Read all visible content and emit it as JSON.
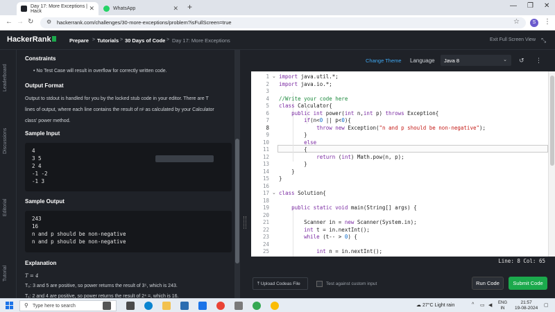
{
  "browser": {
    "tabs": [
      {
        "title": "Day 17: More Exceptions | Hack",
        "active": true
      },
      {
        "title": "WhatsApp",
        "active": false
      }
    ],
    "new_tab": "+",
    "url": "hackerrank.com/challenges/30-more-exceptions/problem?isFullScreen=true",
    "profile_initial": "S"
  },
  "header": {
    "logo": "HackerRank",
    "breadcrumb": [
      "Prepare",
      "Tutorials",
      "30 Days of Code",
      "Day 17: More Exceptions"
    ],
    "separator": ">",
    "exit_full_screen": "Exit Full Screen View"
  },
  "side_tabs": [
    "Leaderboard",
    "Discussions",
    "Editorial",
    "Tutorial"
  ],
  "problem": {
    "constraints_title": "Constraints",
    "constraint_item": "No Test Case will result in overflow for correctly written code.",
    "output_title": "Output Format",
    "output_line1": "Output to stdout is handled for you by the locked stub code in your editor. There are T",
    "output_line2": "lines of output, where each line contains the result of nᵖ as calculated by your Calculator",
    "output_line3": "class' power method.",
    "sample_input_title": "Sample Input",
    "sample_input": [
      "4",
      "3 5",
      "2 4",
      "-1 -2",
      "-1 3"
    ],
    "sample_output_title": "Sample Output",
    "sample_output": [
      "243",
      "16",
      "n and p should be non-negative",
      "n and p should be non-negative"
    ],
    "explanation_title": "Explanation",
    "explanation_t": "T = 4",
    "explanation_1": "T₀: 3 and 5 are positive, so power returns the result of 3⁵, which is 243.",
    "explanation_2": "T₁: 2 and 4 are positive, so power returns the result of 2⁴ =, which is 16."
  },
  "editor": {
    "change_theme": "Change Theme",
    "language_label": "Language",
    "language": "Java 8",
    "line_numbers": [
      "1",
      "2",
      "3",
      "4",
      "5",
      "6",
      "7",
      "8",
      "9",
      "10",
      "11",
      "12",
      "13",
      "14",
      "15",
      "16",
      "17",
      "18",
      "19",
      "20",
      "21",
      "22",
      "23",
      "24",
      "25"
    ],
    "code": {
      "l1a": "import",
      "l1b": " java.util.*;",
      "l2a": "import",
      "l2b": " java.io.*;",
      "l4": "//Write your code here",
      "l5a": "class",
      "l5b": " Calculator{",
      "l6a": "public int",
      "l6b": " power(",
      "l6c": "int",
      "l6d": " n,",
      "l6e": "int",
      "l6f": " p) ",
      "l6g": "throws",
      "l6h": " Exception{",
      "l7a": "if",
      "l7b": "(n<",
      "l7c": "0",
      "l7d": " || p<",
      "l7e": "0",
      "l7f": "){",
      "l8a": "throw new",
      "l8b": " Exception(",
      "l8c": "\"n and p should be non-negative\"",
      "l8d": ");",
      "l9": "}",
      "l10": "else",
      "l11": "{",
      "l12a": "return",
      "l12b": " (",
      "l12c": "int",
      "l12d": ") Math.pow(n, p);",
      "l13": "}",
      "l14": "}",
      "l15": "}",
      "l17a": "class",
      "l17b": " Solution{",
      "l19a": "public static void",
      "l19b": " main(String[] args) {",
      "l21a": "Scanner in = ",
      "l21b": "new",
      "l21c": " Scanner(System.in);",
      "l22a": "int",
      "l22b": " t = in.nextInt();",
      "l23a": "while",
      "l23b": " (t-- > ",
      "l23c": "0",
      "l23d": ") {",
      "l25a": "int",
      "l25b": " n = in.nextInt();"
    },
    "status": "Line: 8 Col: 65",
    "upload_label": "Upload Codeas File",
    "custom_input_label": "Test against custom input",
    "run_label": "Run Code",
    "submit_label": "Submit Code"
  },
  "taskbar": {
    "search_placeholder": "Type here to search",
    "weather": "27°C  Light rain",
    "lang_top": "ENG",
    "lang_bottom": "IN",
    "time": "21:57",
    "date": "19-08-2024"
  },
  "colors": {
    "accent_green": "#1ba94c",
    "link_blue": "#3fa7f0",
    "panel_bg": "#1f2228"
  }
}
